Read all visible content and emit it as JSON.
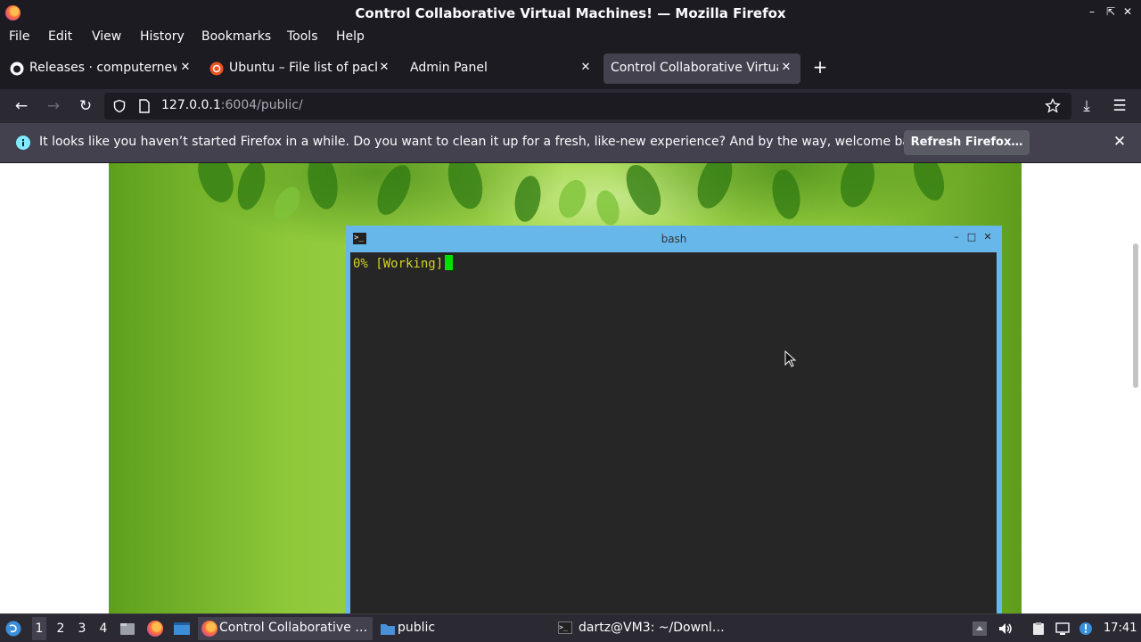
{
  "window": {
    "title": "Control Collaborative Virtual Machines! — Mozilla Firefox"
  },
  "menu": [
    "File",
    "Edit",
    "View",
    "History",
    "Bookmarks",
    "Tools",
    "Help"
  ],
  "tabs": [
    {
      "label": "Releases · computernewb",
      "icon": "github-icon"
    },
    {
      "label": "Ubuntu – File list of packages",
      "icon": "ubuntu-icon"
    },
    {
      "label": "Admin Panel",
      "icon": ""
    },
    {
      "label": "Control Collaborative Virtual Machines!",
      "icon": ""
    }
  ],
  "nav": {
    "url_host": "127.0.0.1",
    "url_rest": ":6004/public/"
  },
  "notification": {
    "message": "It looks like you haven’t started Firefox in a while. Do you want to clean it up for a fresh, like-new experience? And by the way, welcome back!",
    "button": "Refresh Firefox…"
  },
  "terminal": {
    "title": "bash",
    "output": "0% [Working]"
  },
  "taskbar": {
    "workspaces": [
      "1",
      "2",
      "3",
      "4"
    ],
    "active_workspace": "1",
    "tasks": [
      {
        "label": "Control Collaborative …",
        "icon": "firefox-icon"
      },
      {
        "label": "public",
        "icon": "folder-icon"
      },
      {
        "label": "dartz@VM3: ~/Downl…",
        "icon": "terminal-icon"
      }
    ],
    "clock": "17:41"
  },
  "colors": {
    "accent_terminal_border": "#67b7ea",
    "terminal_text": "#d3d327",
    "cursor": "#00e000"
  }
}
